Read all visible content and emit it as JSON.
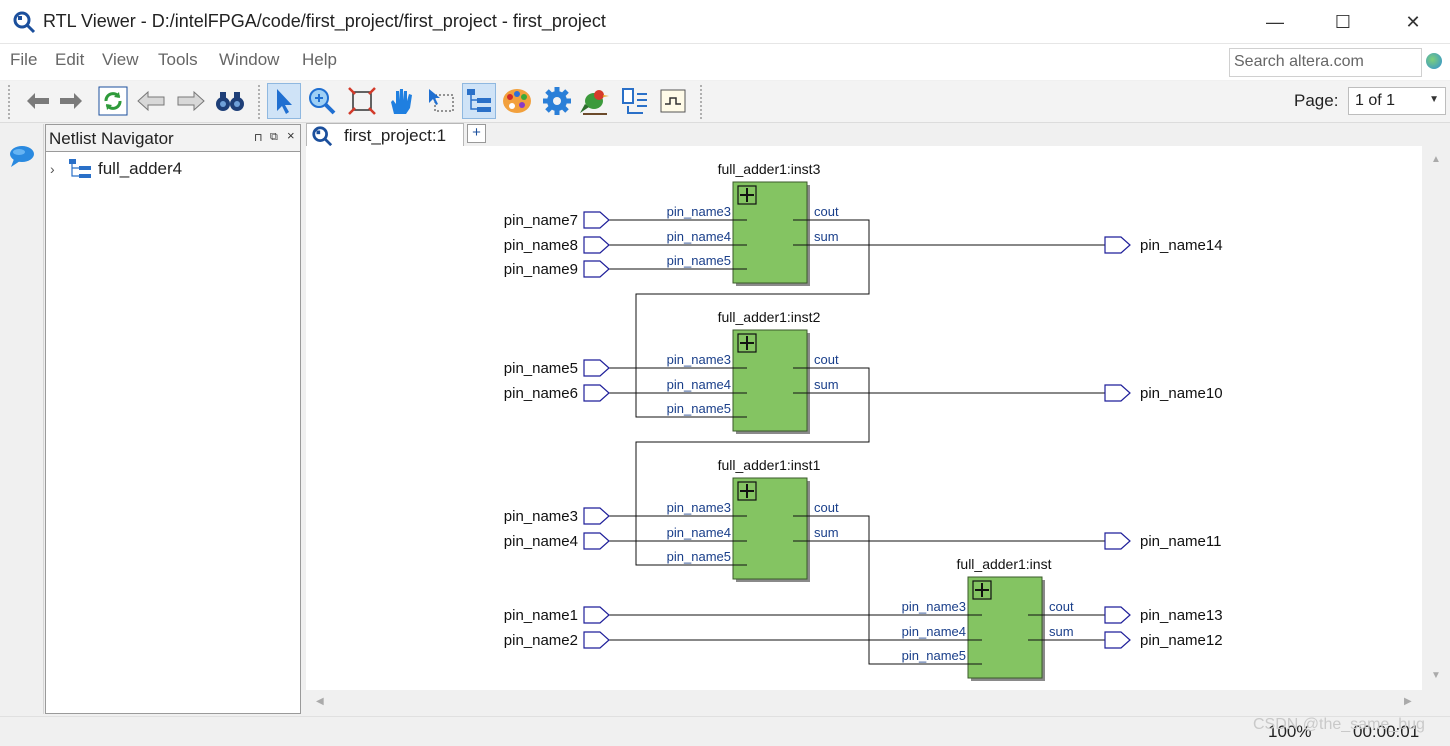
{
  "window": {
    "title": "RTL Viewer - D:/intelFPGA/code/first_project/first_project - first_project",
    "minimize": "—",
    "maximize": "☐",
    "close": "✕"
  },
  "menu": {
    "items": [
      "File",
      "Edit",
      "View",
      "Tools",
      "Window",
      "Help"
    ],
    "search_placeholder": "Search altera.com"
  },
  "toolbar": {
    "buttons": [
      "back-icon",
      "forward-icon",
      "refresh-icon",
      "back-arrow-icon",
      "forward-arrow-icon",
      "binoculars-icon",
      "select-icon",
      "zoom-icon",
      "fit-icon",
      "hand-icon",
      "area-select-icon",
      "hierarchy-icon",
      "color-icon",
      "settings-icon",
      "bird-icon",
      "netlist-icon",
      "print-icon"
    ],
    "active": [
      "select-icon",
      "hierarchy-icon"
    ],
    "page_label": "Page:",
    "page_value": "1 of 1"
  },
  "navigator": {
    "title": "Netlist Navigator",
    "items": [
      {
        "label": "full_adder4",
        "expanded": false
      }
    ]
  },
  "tabs": [
    {
      "label": "first_project:1"
    }
  ],
  "add_tab": "+",
  "schematic": {
    "instances": [
      {
        "name": "full_adder1:inst3",
        "inputs": [
          "pin_name3",
          "pin_name4",
          "pin_name5"
        ],
        "outputs": [
          "cout",
          "sum"
        ]
      },
      {
        "name": "full_adder1:inst2",
        "inputs": [
          "pin_name3",
          "pin_name4",
          "pin_name5"
        ],
        "outputs": [
          "cout",
          "sum"
        ]
      },
      {
        "name": "full_adder1:inst1",
        "inputs": [
          "pin_name3",
          "pin_name4",
          "pin_name5"
        ],
        "outputs": [
          "cout",
          "sum"
        ]
      },
      {
        "name": "full_adder1:inst",
        "inputs": [
          "pin_name3",
          "pin_name4",
          "pin_name5"
        ],
        "outputs": [
          "cout",
          "sum"
        ]
      }
    ],
    "input_pins": [
      "pin_name7",
      "pin_name8",
      "pin_name9",
      "pin_name5",
      "pin_name6",
      "pin_name3",
      "pin_name4",
      "pin_name1",
      "pin_name2"
    ],
    "output_pins": [
      "pin_name14",
      "pin_name10",
      "pin_name11",
      "pin_name13",
      "pin_name12"
    ],
    "colors": {
      "block_fill": "#84c462",
      "wire": "#111111",
      "pin_stroke": "#1f1f9a",
      "port_text": "#1a3f8a"
    }
  },
  "status": {
    "zoom": "100%",
    "time": "00:00:01",
    "watermark": "CSDN @the_same_bug"
  }
}
